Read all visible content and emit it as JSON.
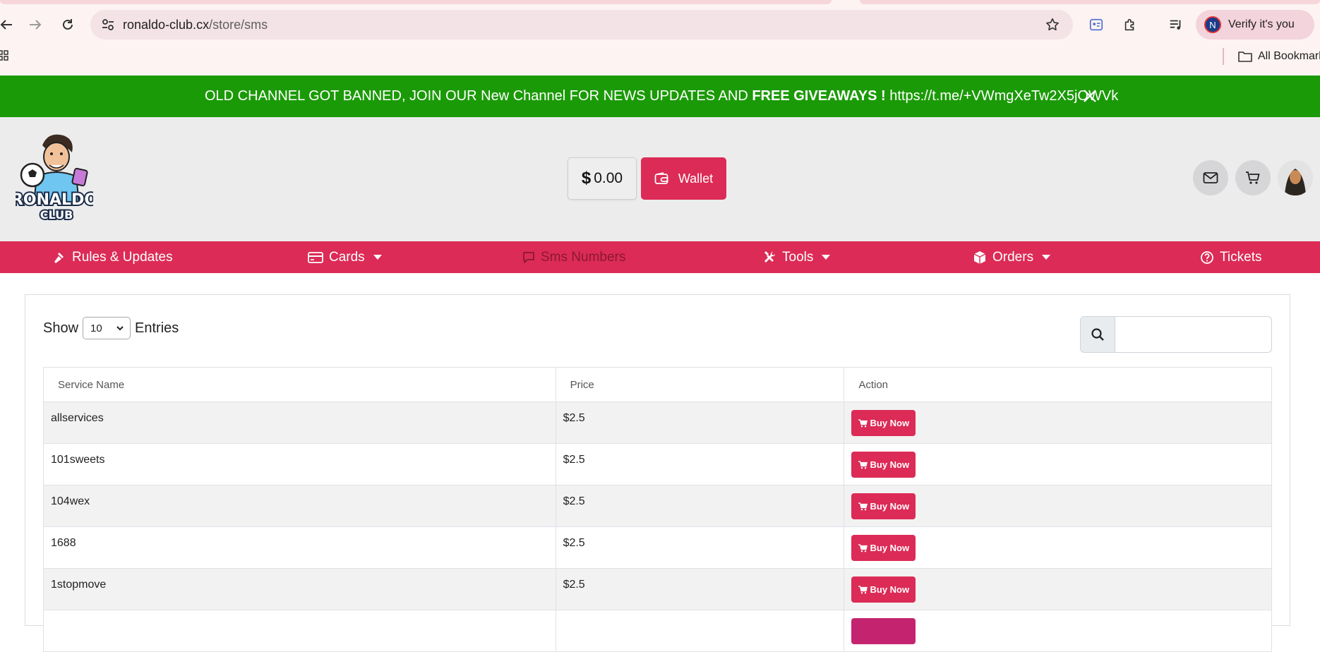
{
  "browser": {
    "url_domain": "ronaldo-club.cx",
    "url_path": "/store/sms",
    "profile_initial": "N",
    "verify_label": "Verify it's you",
    "all_bookmarks_label": "All Bookmark"
  },
  "announcement": {
    "text_plain": "OLD CHANNEL GOT BANNED, JOIN OUR New Channel FOR NEWS UPDATES AND ",
    "text_bold": "FREE GIVEAWAYS !",
    "link": " https://t.me/+VWmgXeTw2X5jOWVk"
  },
  "header": {
    "balance_symbol": "$",
    "balance_value": "0.00",
    "wallet_label": "Wallet"
  },
  "nav": {
    "items": [
      {
        "label": "Rules & Updates",
        "icon": "hammer-icon"
      },
      {
        "label": "Cards",
        "icon": "credit-card-icon",
        "dropdown": true
      },
      {
        "label": "Sms Numbers",
        "icon": "message-icon",
        "active": true
      },
      {
        "label": "Tools",
        "icon": "tools-icon",
        "dropdown": true
      },
      {
        "label": "Orders",
        "icon": "box-icon",
        "dropdown": true
      },
      {
        "label": "Tickets",
        "icon": "question-circle-icon"
      }
    ]
  },
  "table_controls": {
    "show_label": "Show",
    "entries_value": "10",
    "entries_label": "Entries",
    "search_value": ""
  },
  "table": {
    "headers": [
      "Service Name",
      "Price",
      "Action"
    ],
    "rows": [
      {
        "service": "allservices",
        "price": "$2.5"
      },
      {
        "service": "101sweets",
        "price": "$2.5"
      },
      {
        "service": "104wex",
        "price": "$2.5"
      },
      {
        "service": "1688",
        "price": "$2.5"
      },
      {
        "service": "1stopmove",
        "price": "$2.5"
      }
    ],
    "buy_label": "Buy Now"
  },
  "colors": {
    "accent": "#dc2b56",
    "announce_bg": "#1b9a07",
    "header_bg": "#ececec"
  }
}
